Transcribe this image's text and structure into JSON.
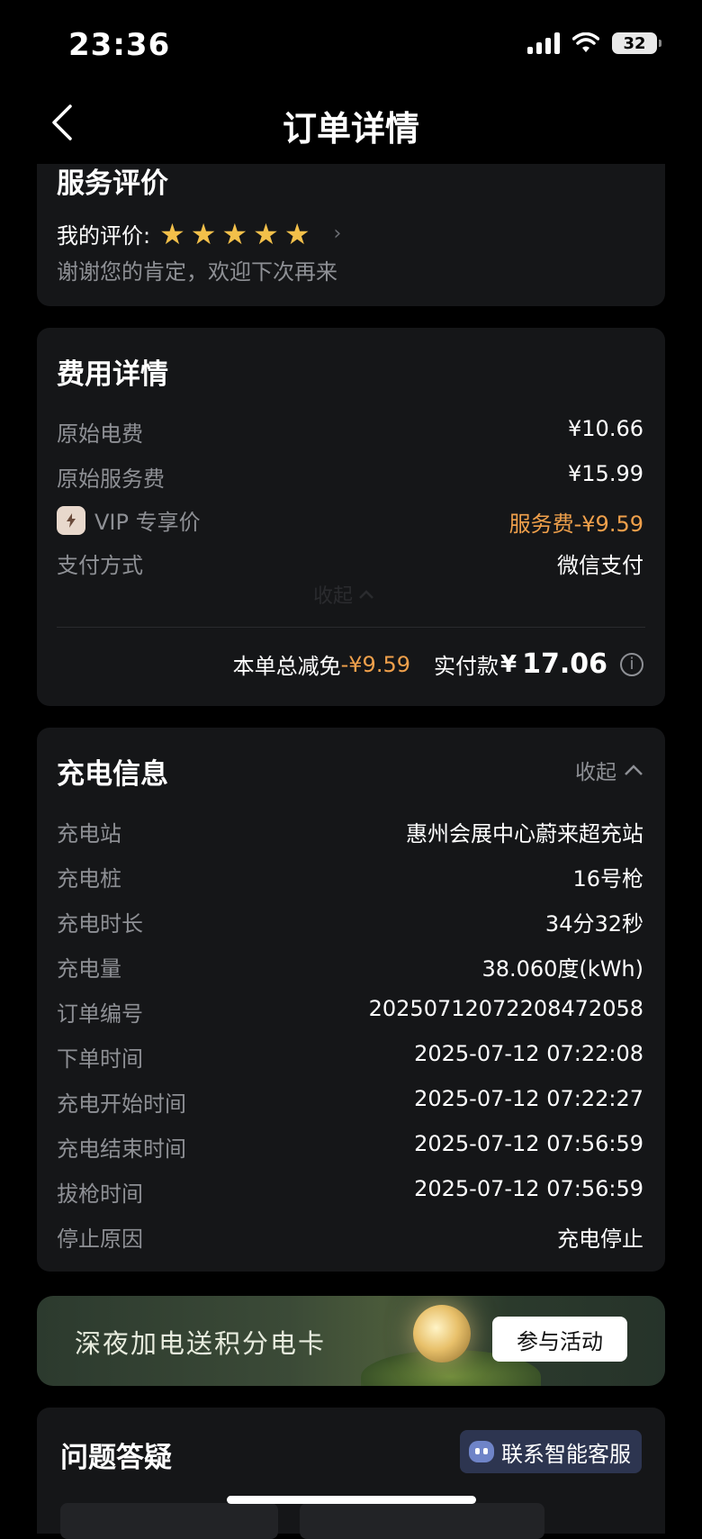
{
  "status_bar": {
    "time": "23:36",
    "battery": "32"
  },
  "nav": {
    "title": "订单详情"
  },
  "review": {
    "title": "服务评价",
    "my_rating_label": "我的评价:",
    "stars": 5,
    "comment": "谢谢您的肯定，欢迎下次再来"
  },
  "fees": {
    "title": "费用详情",
    "rows": [
      {
        "label": "原始电费",
        "value": "¥10.66"
      },
      {
        "label": "原始服务费",
        "value": "¥15.99"
      },
      {
        "label": "VIP 专享价",
        "value": "服务费-¥9.59"
      },
      {
        "label": "支付方式",
        "value": "微信支付"
      }
    ],
    "collapse_label": "收起",
    "total_discount_label": "本单总减免",
    "total_discount_value": "-¥9.59",
    "paid_label": "实付款",
    "paid_currency": "¥",
    "paid_amount": "17.06"
  },
  "charging": {
    "title": "充电信息",
    "collapse_label": "收起",
    "rows": [
      {
        "label": "充电站",
        "value": "惠州会展中心蔚来超充站"
      },
      {
        "label": "充电桩",
        "value": "16号枪"
      },
      {
        "label": "充电时长",
        "value": "34分32秒"
      },
      {
        "label": "充电量",
        "value": "38.060度(kWh)"
      },
      {
        "label": "订单编号",
        "value": "20250712072208472058"
      },
      {
        "label": "下单时间",
        "value": "2025-07-12 07:22:08"
      },
      {
        "label": "充电开始时间",
        "value": "2025-07-12 07:22:27"
      },
      {
        "label": "充电结束时间",
        "value": "2025-07-12 07:56:59"
      },
      {
        "label": "拔枪时间",
        "value": "2025-07-12 07:56:59"
      },
      {
        "label": "停止原因",
        "value": "充电停止"
      }
    ]
  },
  "banner": {
    "text": "深夜加电送积分电卡",
    "button": "参与活动"
  },
  "faq": {
    "title": "问题答疑",
    "contact_button": "联系智能客服"
  },
  "colors": {
    "accent": "#f0a04b",
    "star": "#f3c04a",
    "card_bg": "#151618"
  }
}
